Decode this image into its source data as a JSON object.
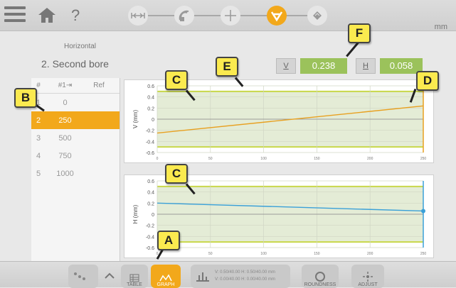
{
  "top": {
    "unit": "mm",
    "modes": [
      "shaft-icon",
      "transmit-icon",
      "crosshair-icon",
      "bore-icon",
      "report-icon"
    ]
  },
  "left": {
    "heading": "Horizontal",
    "bore_title": "2. Second bore",
    "columns": [
      "#",
      "#1⇥",
      "Ref"
    ],
    "rows": [
      {
        "n": "1",
        "v": "0"
      },
      {
        "n": "2",
        "v": "250"
      },
      {
        "n": "3",
        "v": "500"
      },
      {
        "n": "4",
        "v": "750"
      },
      {
        "n": "5",
        "v": "1000"
      }
    ],
    "selected_index": 1
  },
  "readouts": {
    "v_label": "V",
    "v_value": "0.238",
    "h_label": "H",
    "h_value": "0.058"
  },
  "charts": {
    "v": {
      "ylabel": "V (mm)",
      "yticks": [
        "0.6",
        "0.4",
        "0.2",
        "0",
        "-0.2",
        "-0.4",
        "-0.6"
      ],
      "xticks": [
        "0",
        "50",
        "100",
        "150",
        "200",
        "250"
      ]
    },
    "h": {
      "ylabel": "H (mm)",
      "yticks": [
        "0.6",
        "0.4",
        "0.2",
        "0",
        "-0.2",
        "-0.4",
        "-0.6"
      ],
      "xticks": [
        "0",
        "50",
        "100",
        "150",
        "200",
        "250"
      ]
    }
  },
  "callouts": {
    "a": "A",
    "b": "B",
    "c1": "C",
    "c2": "C",
    "d": "D",
    "e": "E",
    "f": "F"
  },
  "bottom": {
    "table": "TABLE",
    "graph": "GRAPH",
    "info1": "V: 0.50/40.00 H: 0.50/40.00 mm",
    "info2": "V: 0.00/40.00 H: 0.00/40.00 mm",
    "roundness": "ROUNDNESS",
    "adjust": "ADJUST"
  },
  "colors": {
    "accent": "#f2a81b",
    "green": "#9bc25b",
    "line_v": "#e8a020",
    "line_h": "#3aa0d8",
    "tol": "#c8d84a"
  }
}
